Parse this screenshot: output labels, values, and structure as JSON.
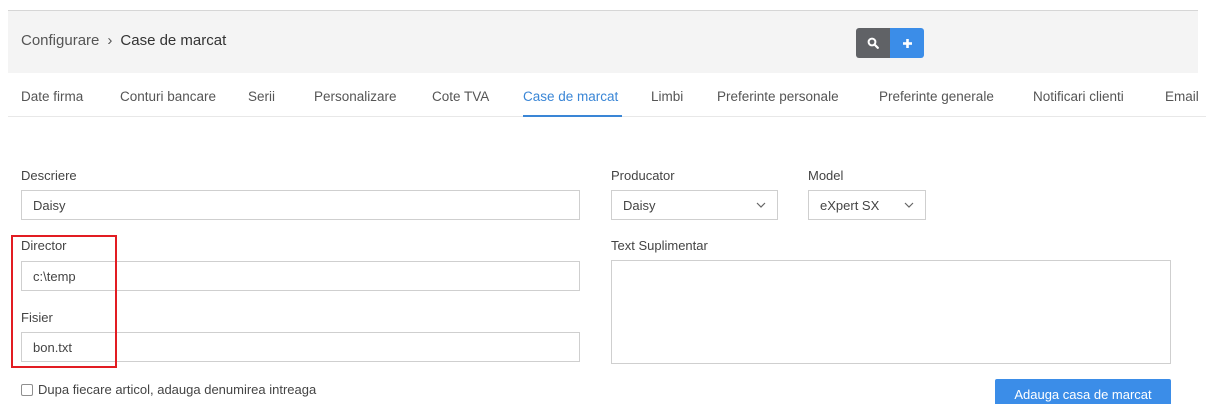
{
  "breadcrumb": {
    "root": "Configurare",
    "separator": "›",
    "current": "Case de marcat"
  },
  "toolbar": {
    "search_icon": "search-icon",
    "add_icon": "plus-icon"
  },
  "tabs": [
    {
      "label": "Date firma"
    },
    {
      "label": "Conturi bancare"
    },
    {
      "label": "Serii"
    },
    {
      "label": "Personalizare"
    },
    {
      "label": "Cote TVA"
    },
    {
      "label": "Case de marcat",
      "active": true
    },
    {
      "label": "Limbi"
    },
    {
      "label": "Preferinte personale"
    },
    {
      "label": "Preferinte generale"
    },
    {
      "label": "Notificari clienti"
    },
    {
      "label": "Email"
    }
  ],
  "form": {
    "descriere": {
      "label": "Descriere",
      "value": "Daisy"
    },
    "producator": {
      "label": "Producator",
      "value": "Daisy"
    },
    "model": {
      "label": "Model",
      "value": "eXpert SX"
    },
    "director": {
      "label": "Director",
      "value": "c:\\temp"
    },
    "text_suplimentar": {
      "label": "Text Suplimentar",
      "value": ""
    },
    "fisier": {
      "label": "Fisier",
      "value": "bon.txt"
    },
    "checkbox": {
      "label": "Dupa fiecare articol, adauga denumirea intreaga",
      "checked": false
    },
    "submit_label": "Adauga casa de marcat"
  },
  "colors": {
    "accent": "#3a86d6",
    "primary_button": "#3b8de8",
    "search_button": "#606266",
    "highlight": "#e21c22"
  }
}
